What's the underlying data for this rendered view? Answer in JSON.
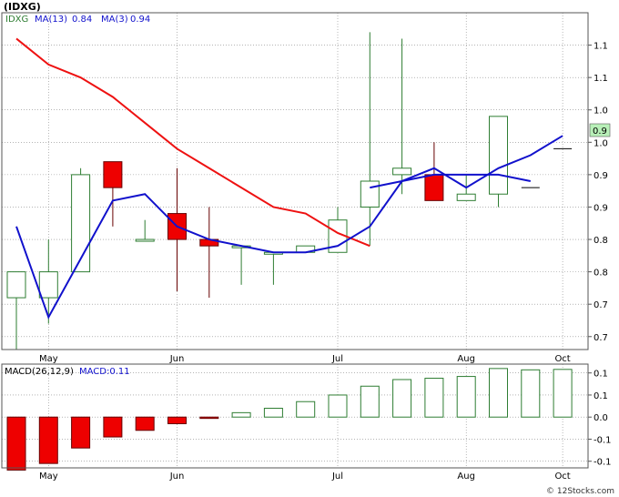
{
  "title": "(IDXG)",
  "legend": {
    "ticker": "IDXG",
    "ma13_label": "MA(13)",
    "ma13_value": "0.84",
    "ma3_label": "MA(3)",
    "ma3_value": "0.94",
    "macd_label": "MACD(26,12,9)",
    "macd_value_label": "MACD:0.11"
  },
  "last_price_tag": "0.9",
  "watermark": "© 12Stocks.com",
  "colors": {
    "up": "#2e7d32",
    "down": "#ee0000",
    "ma13": "#ee1111",
    "ma3": "#1111cc",
    "grid": "#888888",
    "tag_bg": "#b8f0b8"
  },
  "chart_data": [
    {
      "type": "candlestick",
      "interval": "weekly",
      "x_ticks": [
        "May",
        "Jun",
        "Jul",
        "Aug",
        "Oct"
      ],
      "y_tick_labels": [
        "1.1",
        "1.1",
        "1.0",
        "1.0",
        "0.9",
        "0.9",
        "0.8",
        "0.8",
        "0.7",
        "0.7"
      ],
      "y_tick_values": [
        1.15,
        1.1,
        1.05,
        1.0,
        0.95,
        0.9,
        0.85,
        0.8,
        0.75,
        0.7
      ],
      "ylim": [
        0.68,
        1.2
      ],
      "candles": [
        {
          "o": 0.76,
          "h": 0.8,
          "l": 0.68,
          "c": 0.8
        },
        {
          "o": 0.76,
          "h": 0.85,
          "l": 0.72,
          "c": 0.8
        },
        {
          "o": 0.8,
          "h": 0.96,
          "l": 0.8,
          "c": 0.95
        },
        {
          "o": 0.97,
          "h": 0.97,
          "l": 0.87,
          "c": 0.93
        },
        {
          "o": 0.85,
          "h": 0.88,
          "l": 0.85,
          "c": 0.85
        },
        {
          "o": 0.89,
          "h": 0.96,
          "l": 0.77,
          "c": 0.85
        },
        {
          "o": 0.85,
          "h": 0.9,
          "l": 0.76,
          "c": 0.84
        },
        {
          "o": 0.84,
          "h": 0.84,
          "l": 0.78,
          "c": 0.84
        },
        {
          "o": 0.83,
          "h": 0.83,
          "l": 0.78,
          "c": 0.83
        },
        {
          "o": 0.83,
          "h": 0.84,
          "l": 0.83,
          "c": 0.84
        },
        {
          "o": 0.83,
          "h": 0.9,
          "l": 0.83,
          "c": 0.88
        },
        {
          "o": 0.9,
          "h": 1.17,
          "l": 0.84,
          "c": 0.94
        },
        {
          "o": 0.95,
          "h": 1.16,
          "l": 0.92,
          "c": 0.96
        },
        {
          "o": 0.95,
          "h": 1.0,
          "l": 0.91,
          "c": 0.91
        },
        {
          "o": 0.91,
          "h": 0.95,
          "l": 0.91,
          "c": 0.92
        },
        {
          "o": 0.92,
          "h": 1.04,
          "l": 0.9,
          "c": 1.04
        },
        {
          "o": 0.93,
          "h": 0.93,
          "l": 0.93,
          "c": 0.93
        },
        {
          "o": 0.99,
          "h": 0.99,
          "l": 0.99,
          "c": 0.99
        }
      ],
      "ma13": [
        1.16,
        1.12,
        1.1,
        1.07,
        1.03,
        0.99,
        0.96,
        0.93,
        0.9,
        0.89,
        0.86,
        0.84,
        null,
        null,
        null,
        null,
        null,
        null
      ],
      "ma3": [
        0.87,
        0.73,
        0.82,
        0.91,
        0.92,
        0.87,
        0.85,
        0.84,
        0.83,
        0.83,
        0.84,
        0.87,
        0.94,
        0.96,
        0.93,
        0.96,
        0.98,
        1.01
      ],
      "ma13_tail": [
        0.93,
        0.94,
        0.95,
        0.95,
        0.95,
        0.94
      ],
      "ma13_tail_start": 11
    },
    {
      "type": "bar",
      "name": "MACD",
      "y_tick_labels": [
        "0.1",
        "0.1",
        "0.0",
        "-0.1",
        "-0.1"
      ],
      "y_tick_values": [
        0.1,
        0.05,
        0.0,
        -0.05,
        -0.1
      ],
      "ylim": [
        -0.115,
        0.12
      ],
      "values": [
        -0.12,
        -0.105,
        -0.07,
        -0.045,
        -0.03,
        -0.015,
        -0.003,
        0.01,
        0.02,
        0.035,
        0.05,
        0.07,
        0.085,
        0.088,
        0.092,
        0.11,
        0.107,
        0.108
      ]
    }
  ]
}
